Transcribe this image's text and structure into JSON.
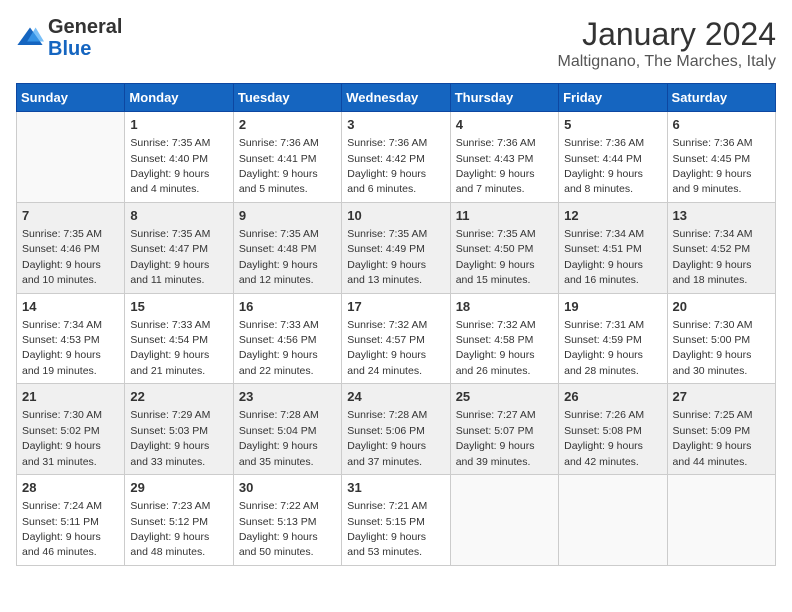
{
  "logo": {
    "general": "General",
    "blue": "Blue"
  },
  "header": {
    "month": "January 2024",
    "location": "Maltignano, The Marches, Italy"
  },
  "weekdays": [
    "Sunday",
    "Monday",
    "Tuesday",
    "Wednesday",
    "Thursday",
    "Friday",
    "Saturday"
  ],
  "weeks": [
    [
      {
        "day": "",
        "info": ""
      },
      {
        "day": "1",
        "info": "Sunrise: 7:35 AM\nSunset: 4:40 PM\nDaylight: 9 hours\nand 4 minutes."
      },
      {
        "day": "2",
        "info": "Sunrise: 7:36 AM\nSunset: 4:41 PM\nDaylight: 9 hours\nand 5 minutes."
      },
      {
        "day": "3",
        "info": "Sunrise: 7:36 AM\nSunset: 4:42 PM\nDaylight: 9 hours\nand 6 minutes."
      },
      {
        "day": "4",
        "info": "Sunrise: 7:36 AM\nSunset: 4:43 PM\nDaylight: 9 hours\nand 7 minutes."
      },
      {
        "day": "5",
        "info": "Sunrise: 7:36 AM\nSunset: 4:44 PM\nDaylight: 9 hours\nand 8 minutes."
      },
      {
        "day": "6",
        "info": "Sunrise: 7:36 AM\nSunset: 4:45 PM\nDaylight: 9 hours\nand 9 minutes."
      }
    ],
    [
      {
        "day": "7",
        "info": "Sunrise: 7:35 AM\nSunset: 4:46 PM\nDaylight: 9 hours\nand 10 minutes."
      },
      {
        "day": "8",
        "info": "Sunrise: 7:35 AM\nSunset: 4:47 PM\nDaylight: 9 hours\nand 11 minutes."
      },
      {
        "day": "9",
        "info": "Sunrise: 7:35 AM\nSunset: 4:48 PM\nDaylight: 9 hours\nand 12 minutes."
      },
      {
        "day": "10",
        "info": "Sunrise: 7:35 AM\nSunset: 4:49 PM\nDaylight: 9 hours\nand 13 minutes."
      },
      {
        "day": "11",
        "info": "Sunrise: 7:35 AM\nSunset: 4:50 PM\nDaylight: 9 hours\nand 15 minutes."
      },
      {
        "day": "12",
        "info": "Sunrise: 7:34 AM\nSunset: 4:51 PM\nDaylight: 9 hours\nand 16 minutes."
      },
      {
        "day": "13",
        "info": "Sunrise: 7:34 AM\nSunset: 4:52 PM\nDaylight: 9 hours\nand 18 minutes."
      }
    ],
    [
      {
        "day": "14",
        "info": "Sunrise: 7:34 AM\nSunset: 4:53 PM\nDaylight: 9 hours\nand 19 minutes."
      },
      {
        "day": "15",
        "info": "Sunrise: 7:33 AM\nSunset: 4:54 PM\nDaylight: 9 hours\nand 21 minutes."
      },
      {
        "day": "16",
        "info": "Sunrise: 7:33 AM\nSunset: 4:56 PM\nDaylight: 9 hours\nand 22 minutes."
      },
      {
        "day": "17",
        "info": "Sunrise: 7:32 AM\nSunset: 4:57 PM\nDaylight: 9 hours\nand 24 minutes."
      },
      {
        "day": "18",
        "info": "Sunrise: 7:32 AM\nSunset: 4:58 PM\nDaylight: 9 hours\nand 26 minutes."
      },
      {
        "day": "19",
        "info": "Sunrise: 7:31 AM\nSunset: 4:59 PM\nDaylight: 9 hours\nand 28 minutes."
      },
      {
        "day": "20",
        "info": "Sunrise: 7:30 AM\nSunset: 5:00 PM\nDaylight: 9 hours\nand 30 minutes."
      }
    ],
    [
      {
        "day": "21",
        "info": "Sunrise: 7:30 AM\nSunset: 5:02 PM\nDaylight: 9 hours\nand 31 minutes."
      },
      {
        "day": "22",
        "info": "Sunrise: 7:29 AM\nSunset: 5:03 PM\nDaylight: 9 hours\nand 33 minutes."
      },
      {
        "day": "23",
        "info": "Sunrise: 7:28 AM\nSunset: 5:04 PM\nDaylight: 9 hours\nand 35 minutes."
      },
      {
        "day": "24",
        "info": "Sunrise: 7:28 AM\nSunset: 5:06 PM\nDaylight: 9 hours\nand 37 minutes."
      },
      {
        "day": "25",
        "info": "Sunrise: 7:27 AM\nSunset: 5:07 PM\nDaylight: 9 hours\nand 39 minutes."
      },
      {
        "day": "26",
        "info": "Sunrise: 7:26 AM\nSunset: 5:08 PM\nDaylight: 9 hours\nand 42 minutes."
      },
      {
        "day": "27",
        "info": "Sunrise: 7:25 AM\nSunset: 5:09 PM\nDaylight: 9 hours\nand 44 minutes."
      }
    ],
    [
      {
        "day": "28",
        "info": "Sunrise: 7:24 AM\nSunset: 5:11 PM\nDaylight: 9 hours\nand 46 minutes."
      },
      {
        "day": "29",
        "info": "Sunrise: 7:23 AM\nSunset: 5:12 PM\nDaylight: 9 hours\nand 48 minutes."
      },
      {
        "day": "30",
        "info": "Sunrise: 7:22 AM\nSunset: 5:13 PM\nDaylight: 9 hours\nand 50 minutes."
      },
      {
        "day": "31",
        "info": "Sunrise: 7:21 AM\nSunset: 5:15 PM\nDaylight: 9 hours\nand 53 minutes."
      },
      {
        "day": "",
        "info": ""
      },
      {
        "day": "",
        "info": ""
      },
      {
        "day": "",
        "info": ""
      }
    ]
  ]
}
